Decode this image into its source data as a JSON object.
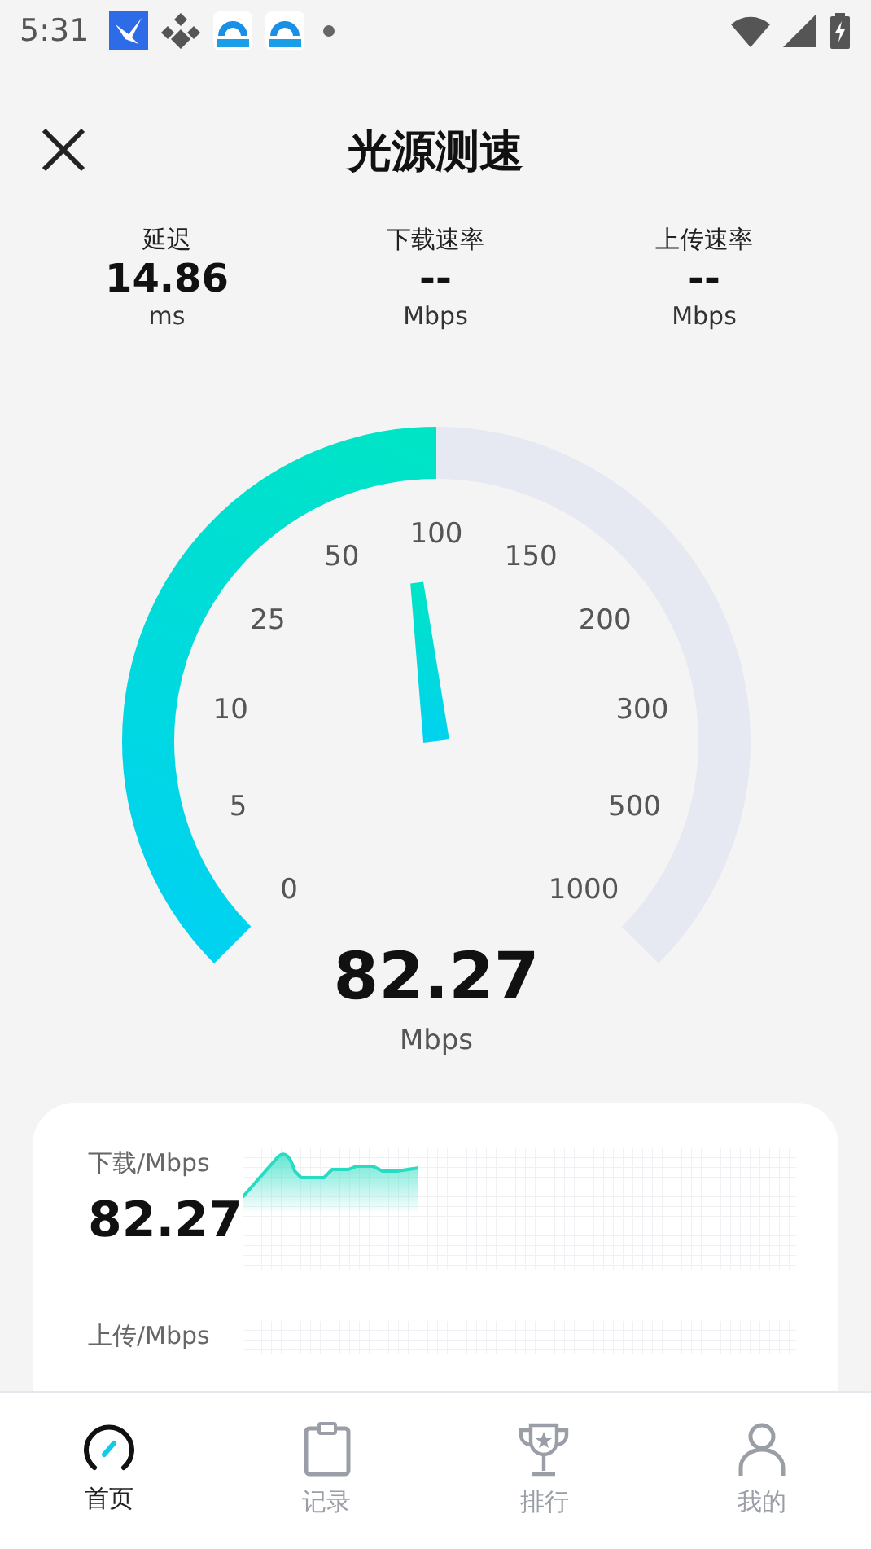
{
  "status_bar": {
    "time": "5:31"
  },
  "header": {
    "title": "光源测速"
  },
  "stats": [
    {
      "label": "延迟",
      "value": "14.86",
      "unit": "ms"
    },
    {
      "label": "下载速率",
      "value": "--",
      "unit": "Mbps"
    },
    {
      "label": "上传速率",
      "value": "--",
      "unit": "Mbps"
    }
  ],
  "gauge": {
    "ticks": [
      "0",
      "5",
      "10",
      "25",
      "50",
      "100",
      "150",
      "200",
      "300",
      "500",
      "1000"
    ],
    "value": "82.27",
    "unit": "Mbps"
  },
  "card": {
    "download_label": "下载/Mbps",
    "download_value": "82.27",
    "upload_label": "上传/Mbps"
  },
  "nav": [
    {
      "label": "首页",
      "selected": true,
      "kind": "gauge"
    },
    {
      "label": "记录",
      "selected": false,
      "kind": "clipboard"
    },
    {
      "label": "排行",
      "selected": false,
      "kind": "trophy"
    },
    {
      "label": "我的",
      "selected": false,
      "kind": "person"
    }
  ]
}
